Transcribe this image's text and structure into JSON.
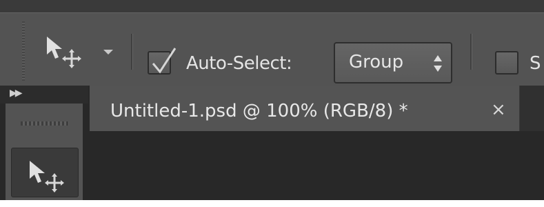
{
  "options_bar": {
    "tool_icon": "move-tool-icon",
    "preset_arrow_icon": "dropdown-arrow-icon",
    "autoselect_label": "Auto-Select:",
    "autoselect_checked": true,
    "group_value": "Group",
    "group_arrow_icon": "up-down-arrows-icon",
    "show_transform_label": "S",
    "show_transform_checked": false
  },
  "panel": {
    "expand_icon": "double-chevron-right-icon",
    "tool_icon": "move-tool-icon"
  },
  "document_tab": {
    "title": "Untitled-1.psd @ 100% (RGB/8) *",
    "close_label": "×",
    "close_icon": "close-icon"
  },
  "colors": {
    "bar": "#535353",
    "workspace": "#282828",
    "text": "#e6e6e6"
  }
}
